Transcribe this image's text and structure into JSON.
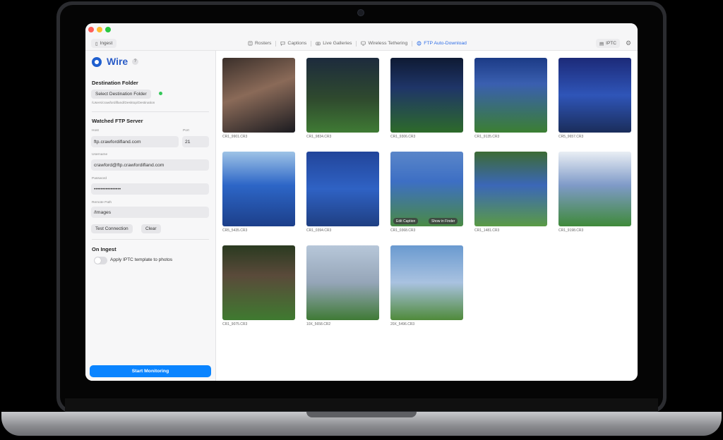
{
  "toolbar": {
    "ingest_label": "Ingest",
    "tabs": [
      {
        "label": "Rosters",
        "icon": "rosters-icon"
      },
      {
        "label": "Captions",
        "icon": "captions-icon"
      },
      {
        "label": "Live Galleries",
        "icon": "camera-icon"
      },
      {
        "label": "Wireless Tethering",
        "icon": "monitor-icon"
      },
      {
        "label": "FTP Auto-Download",
        "icon": "globe-icon"
      }
    ],
    "active_tab": "FTP Auto-Download",
    "iptc_label": "IPTC"
  },
  "sidebar": {
    "brand": "Wire",
    "help": "?",
    "destination": {
      "heading": "Destination Folder",
      "button": "Select Destination Folder",
      "path": "/Users/crawfordifland/Desktop/Destination"
    },
    "ftp": {
      "heading": "Watched FTP Server",
      "host_label": "Host",
      "host_value": "ftp.crawfordifland.com",
      "port_label": "Port",
      "port_value": "21",
      "username_label": "Username",
      "username_value": "crawford@ftp.crawfordifland.com",
      "password_label": "Password",
      "password_value": "••••••••••••••••",
      "remote_label": "Remote Path",
      "remote_value": "/Images",
      "test_button": "Test Connection",
      "clear_button": "Clear"
    },
    "on_ingest": {
      "heading": "On Ingest",
      "toggle_label": "Apply IPTC template to photos",
      "toggle_on": false
    },
    "start_button": "Start Monitoring"
  },
  "photos": [
    {
      "name": "CR1_9901.CR3"
    },
    {
      "name": "CR1_9834.CR3"
    },
    {
      "name": "CR1_9306.CR3"
    },
    {
      "name": "CR1_9135.CR3"
    },
    {
      "name": "CR5_9657.CR3"
    },
    {
      "name": "CR5_5435.CR3"
    },
    {
      "name": "CR1_0394.CR3"
    },
    {
      "name": "CR1_0368.CR3",
      "actions": [
        "Edit Caption",
        "Show in Finder"
      ]
    },
    {
      "name": "CR1_1481.CR3"
    },
    {
      "name": "CR1_9198.CR3"
    },
    {
      "name": "CR1_9075.CR3"
    },
    {
      "name": "10X_5658.CR2"
    },
    {
      "name": "20X_5496.CR3"
    }
  ],
  "colors": {
    "accent": "#0a84ff",
    "brand": "#2a5cc7",
    "status_ok": "#34c759"
  }
}
